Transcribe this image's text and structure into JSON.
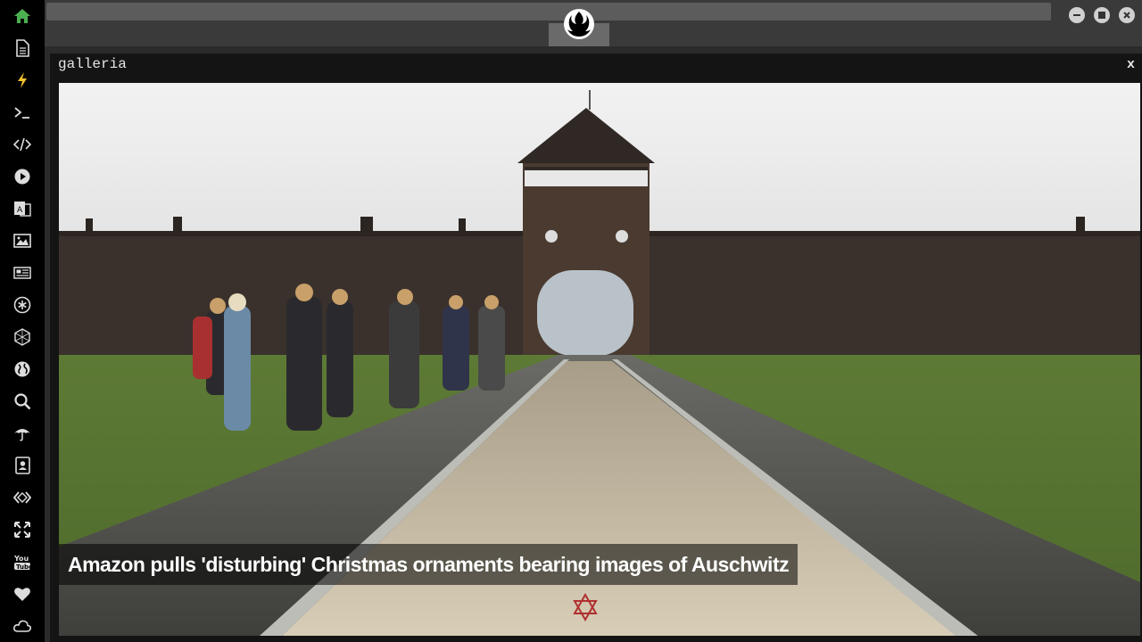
{
  "window": {
    "minimize": "minimize",
    "maximize": "maximize",
    "close": "close"
  },
  "sidebar": {
    "items": [
      {
        "icon": "home-icon"
      },
      {
        "icon": "document-icon"
      },
      {
        "icon": "lightning-icon"
      },
      {
        "icon": "terminal-icon"
      },
      {
        "icon": "code-icon"
      },
      {
        "icon": "play-icon"
      },
      {
        "icon": "translate-icon"
      },
      {
        "icon": "image-icon"
      },
      {
        "icon": "newspaper-icon"
      },
      {
        "icon": "asterisk-icon"
      },
      {
        "icon": "hexagon-icon"
      },
      {
        "icon": "globe-icon"
      },
      {
        "icon": "search-icon"
      },
      {
        "icon": "umbrella-icon"
      },
      {
        "icon": "contact-icon"
      },
      {
        "icon": "embed-icon"
      },
      {
        "icon": "expand-icon"
      },
      {
        "icon": "youtube-icon"
      },
      {
        "icon": "heart-icon"
      },
      {
        "icon": "cloud-icon"
      }
    ],
    "active_color": "#4caf50"
  },
  "panel": {
    "title": "galleria",
    "close_label": "x"
  },
  "gallery": {
    "caption": "Amazon pulls 'disturbing' Christmas ornaments bearing images of Auschwitz"
  }
}
